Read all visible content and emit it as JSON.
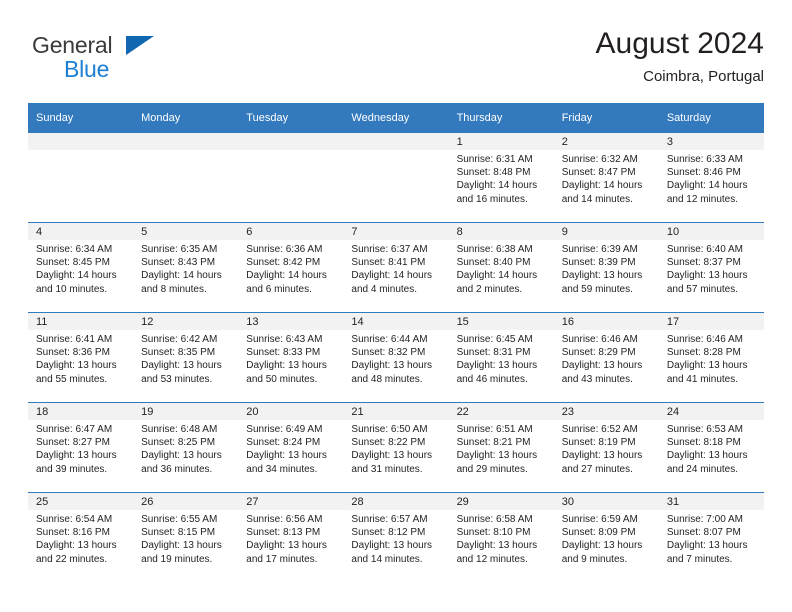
{
  "brand": {
    "word1": "General",
    "word2": "Blue",
    "flag_color": "#1267b1",
    "blue_color": "#1c7fd4"
  },
  "header": {
    "title": "August 2024",
    "subtitle": "Coimbra, Portugal"
  },
  "theme": {
    "header_bg": "#3279bd",
    "number_band_bg": "#f2f2f2",
    "text": "#231f20"
  },
  "labels": {
    "sunrise_prefix": "Sunrise:",
    "sunset_prefix": "Sunset:",
    "daylight_prefix": "Daylight:"
  },
  "weekday_headers": [
    "Sunday",
    "Monday",
    "Tuesday",
    "Wednesday",
    "Thursday",
    "Friday",
    "Saturday"
  ],
  "weeks": [
    [
      {
        "day": "",
        "sunrise": "",
        "sunset": "",
        "daylight_line1": "",
        "daylight_line2": ""
      },
      {
        "day": "",
        "sunrise": "",
        "sunset": "",
        "daylight_line1": "",
        "daylight_line2": ""
      },
      {
        "day": "",
        "sunrise": "",
        "sunset": "",
        "daylight_line1": "",
        "daylight_line2": ""
      },
      {
        "day": "",
        "sunrise": "",
        "sunset": "",
        "daylight_line1": "",
        "daylight_line2": ""
      },
      {
        "day": "1",
        "sunrise": "Sunrise: 6:31 AM",
        "sunset": "Sunset: 8:48 PM",
        "daylight_line1": "Daylight: 14 hours",
        "daylight_line2": "and 16 minutes."
      },
      {
        "day": "2",
        "sunrise": "Sunrise: 6:32 AM",
        "sunset": "Sunset: 8:47 PM",
        "daylight_line1": "Daylight: 14 hours",
        "daylight_line2": "and 14 minutes."
      },
      {
        "day": "3",
        "sunrise": "Sunrise: 6:33 AM",
        "sunset": "Sunset: 8:46 PM",
        "daylight_line1": "Daylight: 14 hours",
        "daylight_line2": "and 12 minutes."
      }
    ],
    [
      {
        "day": "4",
        "sunrise": "Sunrise: 6:34 AM",
        "sunset": "Sunset: 8:45 PM",
        "daylight_line1": "Daylight: 14 hours",
        "daylight_line2": "and 10 minutes."
      },
      {
        "day": "5",
        "sunrise": "Sunrise: 6:35 AM",
        "sunset": "Sunset: 8:43 PM",
        "daylight_line1": "Daylight: 14 hours",
        "daylight_line2": "and 8 minutes."
      },
      {
        "day": "6",
        "sunrise": "Sunrise: 6:36 AM",
        "sunset": "Sunset: 8:42 PM",
        "daylight_line1": "Daylight: 14 hours",
        "daylight_line2": "and 6 minutes."
      },
      {
        "day": "7",
        "sunrise": "Sunrise: 6:37 AM",
        "sunset": "Sunset: 8:41 PM",
        "daylight_line1": "Daylight: 14 hours",
        "daylight_line2": "and 4 minutes."
      },
      {
        "day": "8",
        "sunrise": "Sunrise: 6:38 AM",
        "sunset": "Sunset: 8:40 PM",
        "daylight_line1": "Daylight: 14 hours",
        "daylight_line2": "and 2 minutes."
      },
      {
        "day": "9",
        "sunrise": "Sunrise: 6:39 AM",
        "sunset": "Sunset: 8:39 PM",
        "daylight_line1": "Daylight: 13 hours",
        "daylight_line2": "and 59 minutes."
      },
      {
        "day": "10",
        "sunrise": "Sunrise: 6:40 AM",
        "sunset": "Sunset: 8:37 PM",
        "daylight_line1": "Daylight: 13 hours",
        "daylight_line2": "and 57 minutes."
      }
    ],
    [
      {
        "day": "11",
        "sunrise": "Sunrise: 6:41 AM",
        "sunset": "Sunset: 8:36 PM",
        "daylight_line1": "Daylight: 13 hours",
        "daylight_line2": "and 55 minutes."
      },
      {
        "day": "12",
        "sunrise": "Sunrise: 6:42 AM",
        "sunset": "Sunset: 8:35 PM",
        "daylight_line1": "Daylight: 13 hours",
        "daylight_line2": "and 53 minutes."
      },
      {
        "day": "13",
        "sunrise": "Sunrise: 6:43 AM",
        "sunset": "Sunset: 8:33 PM",
        "daylight_line1": "Daylight: 13 hours",
        "daylight_line2": "and 50 minutes."
      },
      {
        "day": "14",
        "sunrise": "Sunrise: 6:44 AM",
        "sunset": "Sunset: 8:32 PM",
        "daylight_line1": "Daylight: 13 hours",
        "daylight_line2": "and 48 minutes."
      },
      {
        "day": "15",
        "sunrise": "Sunrise: 6:45 AM",
        "sunset": "Sunset: 8:31 PM",
        "daylight_line1": "Daylight: 13 hours",
        "daylight_line2": "and 46 minutes."
      },
      {
        "day": "16",
        "sunrise": "Sunrise: 6:46 AM",
        "sunset": "Sunset: 8:29 PM",
        "daylight_line1": "Daylight: 13 hours",
        "daylight_line2": "and 43 minutes."
      },
      {
        "day": "17",
        "sunrise": "Sunrise: 6:46 AM",
        "sunset": "Sunset: 8:28 PM",
        "daylight_line1": "Daylight: 13 hours",
        "daylight_line2": "and 41 minutes."
      }
    ],
    [
      {
        "day": "18",
        "sunrise": "Sunrise: 6:47 AM",
        "sunset": "Sunset: 8:27 PM",
        "daylight_line1": "Daylight: 13 hours",
        "daylight_line2": "and 39 minutes."
      },
      {
        "day": "19",
        "sunrise": "Sunrise: 6:48 AM",
        "sunset": "Sunset: 8:25 PM",
        "daylight_line1": "Daylight: 13 hours",
        "daylight_line2": "and 36 minutes."
      },
      {
        "day": "20",
        "sunrise": "Sunrise: 6:49 AM",
        "sunset": "Sunset: 8:24 PM",
        "daylight_line1": "Daylight: 13 hours",
        "daylight_line2": "and 34 minutes."
      },
      {
        "day": "21",
        "sunrise": "Sunrise: 6:50 AM",
        "sunset": "Sunset: 8:22 PM",
        "daylight_line1": "Daylight: 13 hours",
        "daylight_line2": "and 31 minutes."
      },
      {
        "day": "22",
        "sunrise": "Sunrise: 6:51 AM",
        "sunset": "Sunset: 8:21 PM",
        "daylight_line1": "Daylight: 13 hours",
        "daylight_line2": "and 29 minutes."
      },
      {
        "day": "23",
        "sunrise": "Sunrise: 6:52 AM",
        "sunset": "Sunset: 8:19 PM",
        "daylight_line1": "Daylight: 13 hours",
        "daylight_line2": "and 27 minutes."
      },
      {
        "day": "24",
        "sunrise": "Sunrise: 6:53 AM",
        "sunset": "Sunset: 8:18 PM",
        "daylight_line1": "Daylight: 13 hours",
        "daylight_line2": "and 24 minutes."
      }
    ],
    [
      {
        "day": "25",
        "sunrise": "Sunrise: 6:54 AM",
        "sunset": "Sunset: 8:16 PM",
        "daylight_line1": "Daylight: 13 hours",
        "daylight_line2": "and 22 minutes."
      },
      {
        "day": "26",
        "sunrise": "Sunrise: 6:55 AM",
        "sunset": "Sunset: 8:15 PM",
        "daylight_line1": "Daylight: 13 hours",
        "daylight_line2": "and 19 minutes."
      },
      {
        "day": "27",
        "sunrise": "Sunrise: 6:56 AM",
        "sunset": "Sunset: 8:13 PM",
        "daylight_line1": "Daylight: 13 hours",
        "daylight_line2": "and 17 minutes."
      },
      {
        "day": "28",
        "sunrise": "Sunrise: 6:57 AM",
        "sunset": "Sunset: 8:12 PM",
        "daylight_line1": "Daylight: 13 hours",
        "daylight_line2": "and 14 minutes."
      },
      {
        "day": "29",
        "sunrise": "Sunrise: 6:58 AM",
        "sunset": "Sunset: 8:10 PM",
        "daylight_line1": "Daylight: 13 hours",
        "daylight_line2": "and 12 minutes."
      },
      {
        "day": "30",
        "sunrise": "Sunrise: 6:59 AM",
        "sunset": "Sunset: 8:09 PM",
        "daylight_line1": "Daylight: 13 hours",
        "daylight_line2": "and 9 minutes."
      },
      {
        "day": "31",
        "sunrise": "Sunrise: 7:00 AM",
        "sunset": "Sunset: 8:07 PM",
        "daylight_line1": "Daylight: 13 hours",
        "daylight_line2": "and 7 minutes."
      }
    ]
  ]
}
